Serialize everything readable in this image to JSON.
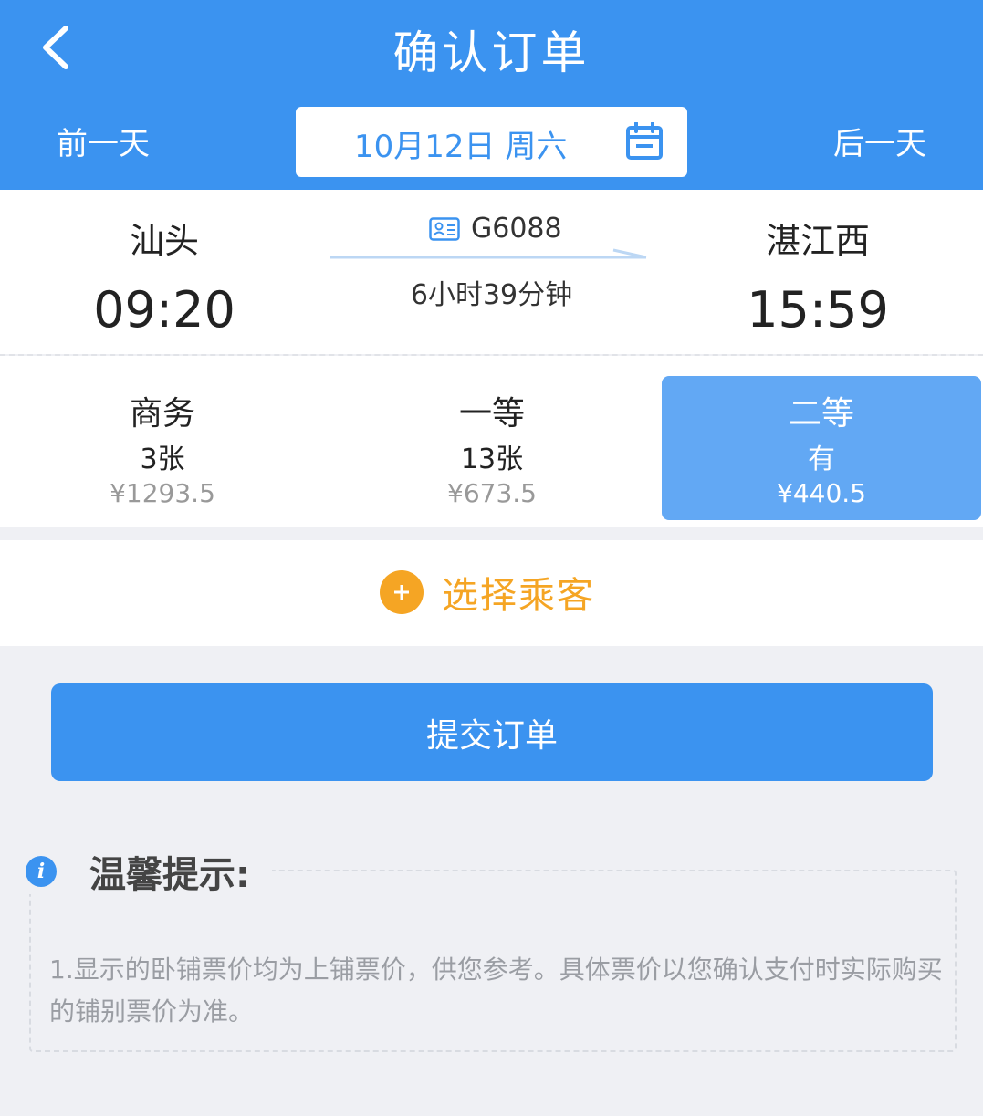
{
  "header": {
    "title": "确认订单",
    "prev_day": "前一天",
    "next_day": "后一天",
    "date": "10月12日 周六"
  },
  "train": {
    "from_station": "汕头",
    "to_station": "湛江西",
    "depart_time": "09:20",
    "arrive_time": "15:59",
    "train_no": "G6088",
    "duration": "6小时39分钟"
  },
  "seats": [
    {
      "name": "商务",
      "count": "3张",
      "price": "¥1293.5",
      "selected": false
    },
    {
      "name": "一等",
      "count": "13张",
      "price": "¥673.5",
      "selected": false
    },
    {
      "name": "二等",
      "count": "有",
      "price": "¥440.5",
      "selected": true
    }
  ],
  "passenger": {
    "select_label": "选择乘客"
  },
  "submit": {
    "label": "提交订单"
  },
  "tips": {
    "title": "温馨提示:",
    "text": "1.显示的卧铺票价均为上铺票价，供您参考。具体票价以您确认支付时实际购买的铺别票价为准。"
  },
  "colors": {
    "primary": "#3b93f0",
    "selected_seat": "#62a8f4",
    "accent_orange": "#f5a524",
    "background": "#eff0f4"
  },
  "icons": [
    "back-arrow-icon",
    "calendar-icon",
    "train-id-icon",
    "plus-icon",
    "info-icon"
  ]
}
